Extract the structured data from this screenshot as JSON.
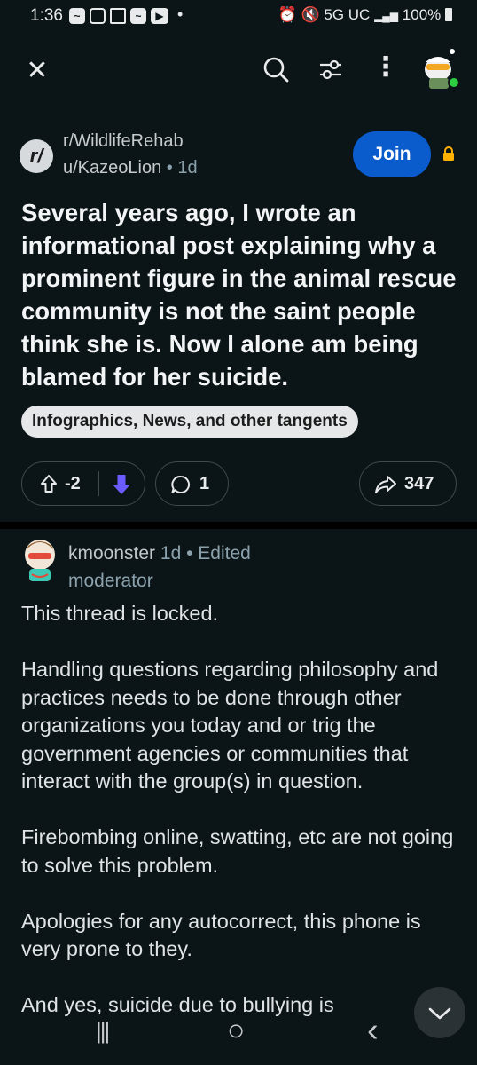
{
  "status_bar": {
    "time": "1:36",
    "left_icons": [
      "app-icon",
      "instagram-icon",
      "news-icon",
      "app-icon",
      "youtube-icon"
    ],
    "dot": "•",
    "network": "5G UC",
    "battery": "100%"
  },
  "toolbar": {
    "close_glyph": "✕",
    "more_glyph": "⋮"
  },
  "post": {
    "subreddit": "r/WildlifeRehab",
    "subreddit_icon_text": "r/",
    "author": "u/KazeoLion",
    "separator": "•",
    "age": "1d",
    "join_label": "Join",
    "title": "Several years ago, I wrote an informational post explaining why a prominent figure in the animal rescue community is not the saint people think she is. Now I alone am being blamed for her suicide.",
    "flair": "Infographics, News, and other tangents",
    "score": "-2",
    "comment_count": "1",
    "share_count": "347"
  },
  "comment": {
    "username": "kmoonster",
    "age": "1d",
    "separator": "•",
    "edited": "Edited",
    "role": "moderator",
    "paragraphs": [
      "This thread is locked.",
      "Handling questions regarding philosophy and practices needs to be done through other organizations you today and or trig the government agencies or communities that interact with the group(s) in question.",
      "Firebombing online, swatting, etc are not going to solve this problem.",
      "Apologies for any autocorrect, this phone is very prone to they.",
      "And yes, suicide due to bullying is"
    ]
  },
  "colors": {
    "background": "#0b1416",
    "join_button": "#0a5ccd",
    "downvote_active": "#6a5cff",
    "lock_icon": "#ffb000"
  },
  "navbar": {
    "recents_glyph": "|||",
    "home_glyph": "○",
    "back_glyph": "‹"
  }
}
